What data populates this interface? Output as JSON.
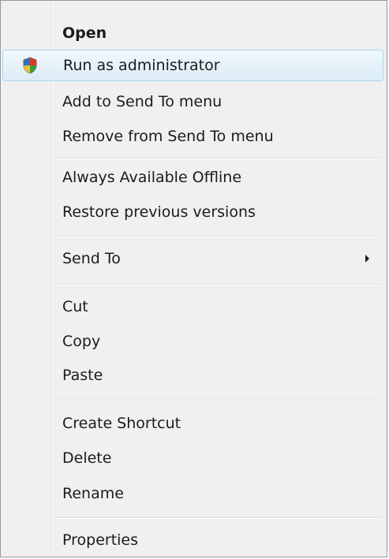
{
  "menu": {
    "items": [
      {
        "label": "Open",
        "bold": true
      },
      {
        "label": "Run as administrator",
        "icon": "uac-shield-icon",
        "highlighted": true
      },
      {
        "label": "Add to Send To menu"
      },
      {
        "label": "Remove from Send To menu"
      },
      {
        "label": "Always Available Offline"
      },
      {
        "label": "Restore previous versions"
      },
      {
        "label": "Send To",
        "submenu_icon": "chevron-right-icon"
      },
      {
        "label": "Cut"
      },
      {
        "label": "Copy"
      },
      {
        "label": "Paste"
      },
      {
        "label": "Create Shortcut"
      },
      {
        "label": "Delete"
      },
      {
        "label": "Rename"
      },
      {
        "label": "Properties"
      }
    ]
  },
  "colors": {
    "menu_background": "#f0f0f0",
    "highlight_border": "#a8d8eb",
    "highlight_fill": "#dcecf5",
    "text": "#1b1b1b"
  }
}
